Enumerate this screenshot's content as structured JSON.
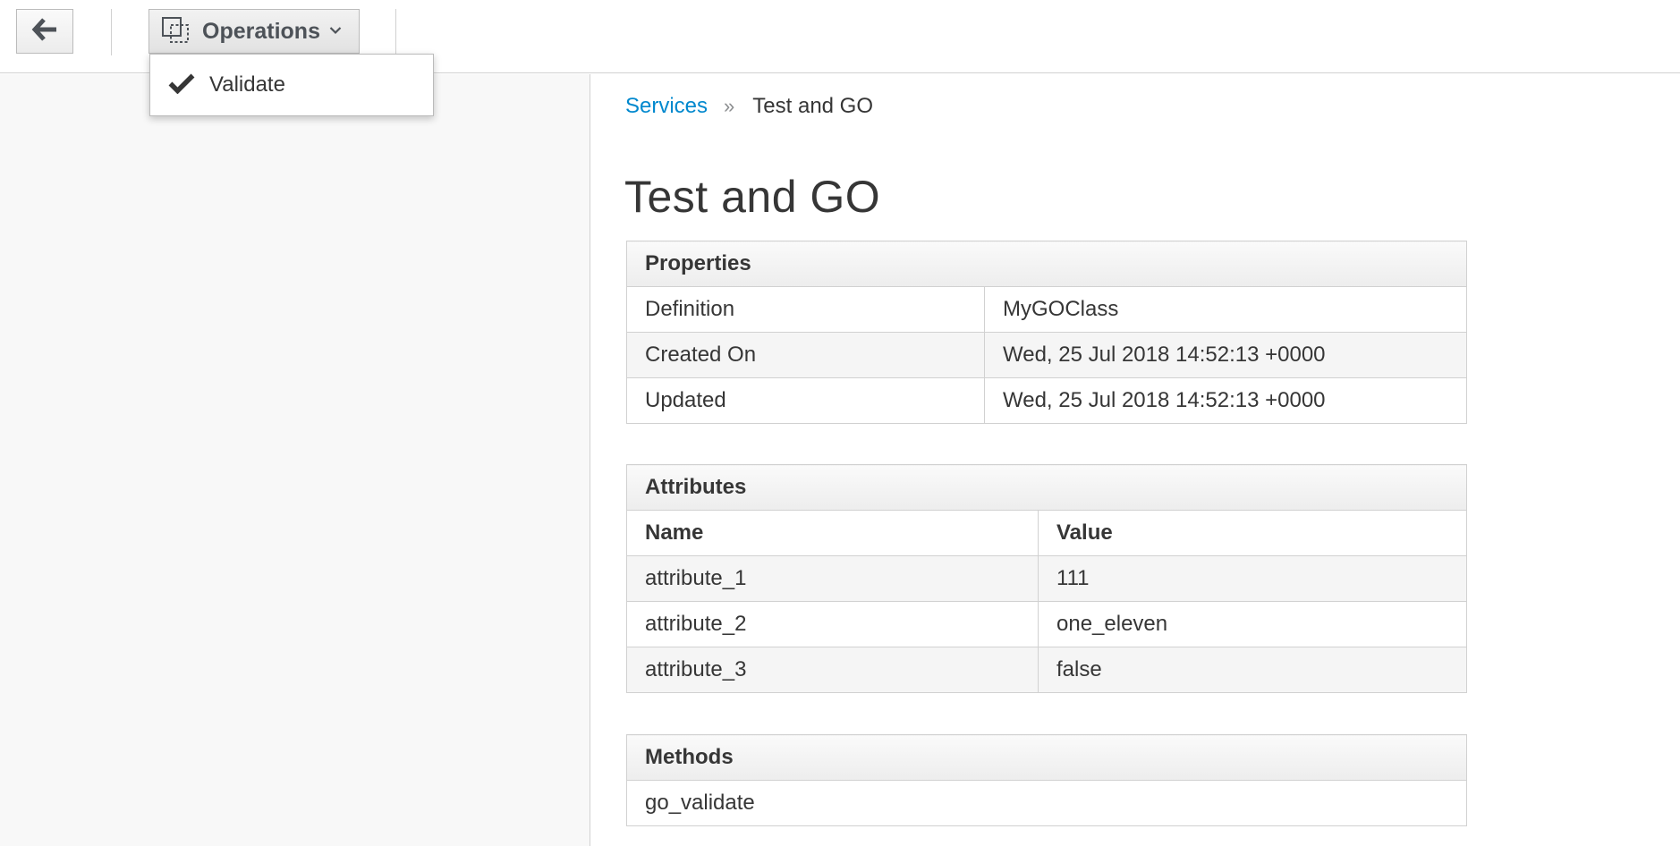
{
  "toolbar": {
    "operations_label": "Operations",
    "dropdown": {
      "items": [
        {
          "label": "Validate"
        }
      ]
    }
  },
  "breadcrumb": {
    "parent": "Services",
    "separator": "»",
    "current": "Test and GO"
  },
  "page_title": "Test and GO",
  "properties": {
    "heading": "Properties",
    "rows": [
      {
        "label": "Definition",
        "value": "MyGOClass"
      },
      {
        "label": "Created On",
        "value": "Wed, 25 Jul 2018 14:52:13 +0000"
      },
      {
        "label": "Updated",
        "value": "Wed, 25 Jul 2018 14:52:13 +0000"
      }
    ]
  },
  "attributes": {
    "heading": "Attributes",
    "columns": [
      "Name",
      "Value"
    ],
    "rows": [
      {
        "name": "attribute_1",
        "value": "111"
      },
      {
        "name": "attribute_2",
        "value": "one_eleven"
      },
      {
        "name": "attribute_3",
        "value": "false"
      }
    ]
  },
  "methods": {
    "heading": "Methods",
    "rows": [
      {
        "name": "go_validate"
      }
    ]
  },
  "icons": {
    "back": "arrow-left-icon",
    "operations": "operations-icon",
    "caret": "chevron-down-icon",
    "validate": "checkmark-icon"
  },
  "colors": {
    "link": "#0088ce",
    "sidebar_bg": "#f8f8f8",
    "border": "#d1d1d1"
  }
}
